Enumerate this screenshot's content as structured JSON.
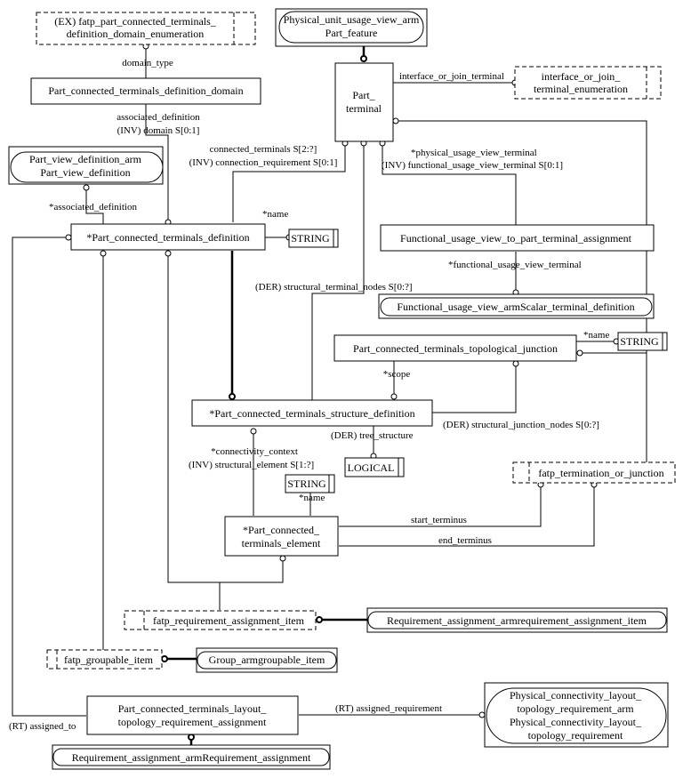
{
  "diagram": {
    "entities": {
      "fatp_domain_enum": {
        "lines": [
          "(EX) fatp_part_connected_terminals_",
          "definition_domain_enumeration"
        ]
      },
      "physical_unit_part_feature": {
        "lines": [
          "Physical_unit_usage_view_arm",
          "Part_feature"
        ]
      },
      "part_terminal": {
        "lines": [
          "Part_",
          "terminal"
        ]
      },
      "interface_or_join_enum": {
        "lines": [
          "interface_or_join_",
          "terminal_enumeration"
        ]
      },
      "pct_definition_domain": {
        "lines": [
          "Part_connected_terminals_definition_domain"
        ]
      },
      "part_view_definition": {
        "lines": [
          "Part_view_definition_arm",
          "Part_view_definition"
        ]
      },
      "pct_definition": {
        "lines": [
          "*Part_connected_terminals_definition"
        ]
      },
      "string1": {
        "lines": [
          "STRING"
        ]
      },
      "fuv_to_pt_assignment": {
        "lines": [
          "Functional_usage_view_to_part_terminal_assignment"
        ]
      },
      "fuv_scalar_terminal": {
        "lines": [
          "Functional_usage_view_armScalar_terminal_definition"
        ]
      },
      "pct_topological_junction": {
        "lines": [
          "Part_connected_terminals_topological_junction"
        ]
      },
      "string2": {
        "lines": [
          "STRING"
        ]
      },
      "pct_structure_definition": {
        "lines": [
          "*Part_connected_terminals_structure_definition"
        ]
      },
      "logical": {
        "lines": [
          "LOGICAL"
        ]
      },
      "string3": {
        "lines": [
          "STRING"
        ]
      },
      "fatp_termination_or_junction": {
        "lines": [
          "fatp_termination_or_junction"
        ]
      },
      "pct_element": {
        "lines": [
          "*Part_connected_",
          "terminals_element"
        ]
      },
      "fatp_requirement_assignment_item": {
        "lines": [
          "fatp_requirement_assignment_item"
        ]
      },
      "req_assignment_item": {
        "lines": [
          "Requirement_assignment_armrequirement_assignment_item"
        ]
      },
      "fatp_groupable_item": {
        "lines": [
          "fatp_groupable_item"
        ]
      },
      "group_groupable_item": {
        "lines": [
          "Group_armgroupable_item"
        ]
      },
      "pct_layout_req_assignment": {
        "lines": [
          "Part_connected_terminals_layout_",
          "topology_requirement_assignment"
        ]
      },
      "physical_connectivity_req": {
        "lines": [
          "Physical_connectivity_layout_",
          "topology_requirement_arm",
          "Physical_connectivity_layout_",
          "topology_requirement"
        ]
      },
      "req_assignment": {
        "lines": [
          "Requirement_assignment_armRequirement_assignment"
        ]
      }
    },
    "labels": {
      "domain_type": "domain_type",
      "associated_definition": "associated_definition",
      "inv_domain": "(INV) domain S[0:1]",
      "connected_terminals": "connected_terminals S[2:?]",
      "inv_connection_requirement": "(INV) connection_requirement S[0:1]",
      "interface_or_join_terminal": "interface_or_join_terminal",
      "physical_usage_view_terminal": "*physical_usage_view_terminal",
      "inv_functional_usage_view_terminal": "(INV) functional_usage_view_terminal S[0:1]",
      "star_associated_definition": "*associated_definition",
      "name1": "*name",
      "functional_usage_view_terminal": "*functional_usage_view_terminal",
      "der_structural_terminal_nodes": "(DER) structural_terminal_nodes S[0:?]",
      "name2": "*name",
      "scope": "*scope",
      "der_structural_junction_nodes": "(DER) structural_junction_nodes S[0:?]",
      "der_tree_structure": "(DER) tree_structure",
      "connectivity_context": "*connectivity_context",
      "inv_structural_element": "(INV) structural_element S[1:?]",
      "name3": "*name",
      "start_terminus": "start_terminus",
      "end_terminus": "end_terminus",
      "rt_assigned_requirement": "(RT) assigned_requirement",
      "rt_assigned_to": "(RT) assigned_to"
    }
  }
}
